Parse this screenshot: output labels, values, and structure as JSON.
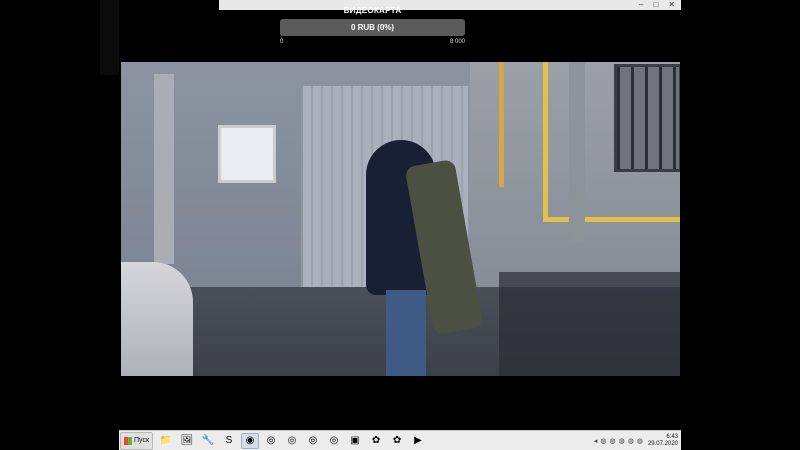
{
  "window": {
    "controls": [
      "–",
      "□",
      "✕"
    ]
  },
  "goal_widget": {
    "title": "ВИДЕОКАРТА",
    "amount_text": "0 RUB (0%)",
    "progress_percent": 0,
    "scale_min": "0",
    "scale_max": "8 000",
    "bar_color": "#5b5b5b"
  },
  "taskbar": {
    "start_label": "Пуск",
    "tasks": [
      {
        "icon": "folder-icon",
        "glyph": "📁",
        "active": false
      },
      {
        "icon": "photo-viewer-icon",
        "glyph": "🖼",
        "active": false
      },
      {
        "icon": "tools-icon",
        "glyph": "🔧",
        "active": false
      },
      {
        "icon": "skype-icon",
        "glyph": "S",
        "active": false
      },
      {
        "icon": "obs-icon",
        "glyph": "◉",
        "active": true
      },
      {
        "icon": "chrome-icon",
        "glyph": "◎",
        "active": false
      },
      {
        "icon": "chrome-icon",
        "glyph": "◎",
        "active": false
      },
      {
        "icon": "chrome-icon",
        "glyph": "◎",
        "active": false
      },
      {
        "icon": "chrome-icon",
        "glyph": "◎",
        "active": false
      },
      {
        "icon": "image-editor-icon",
        "glyph": "▣",
        "active": false
      },
      {
        "icon": "game-icon",
        "glyph": "✿",
        "active": false
      },
      {
        "icon": "game-icon",
        "glyph": "✿",
        "active": false
      },
      {
        "icon": "media-player-icon",
        "glyph": "▶",
        "active": false
      }
    ],
    "tray_icons": [
      "◂",
      "◍",
      "◍",
      "◍",
      "◍",
      "◍"
    ],
    "time": "6:43",
    "date": "29.07.2020"
  }
}
